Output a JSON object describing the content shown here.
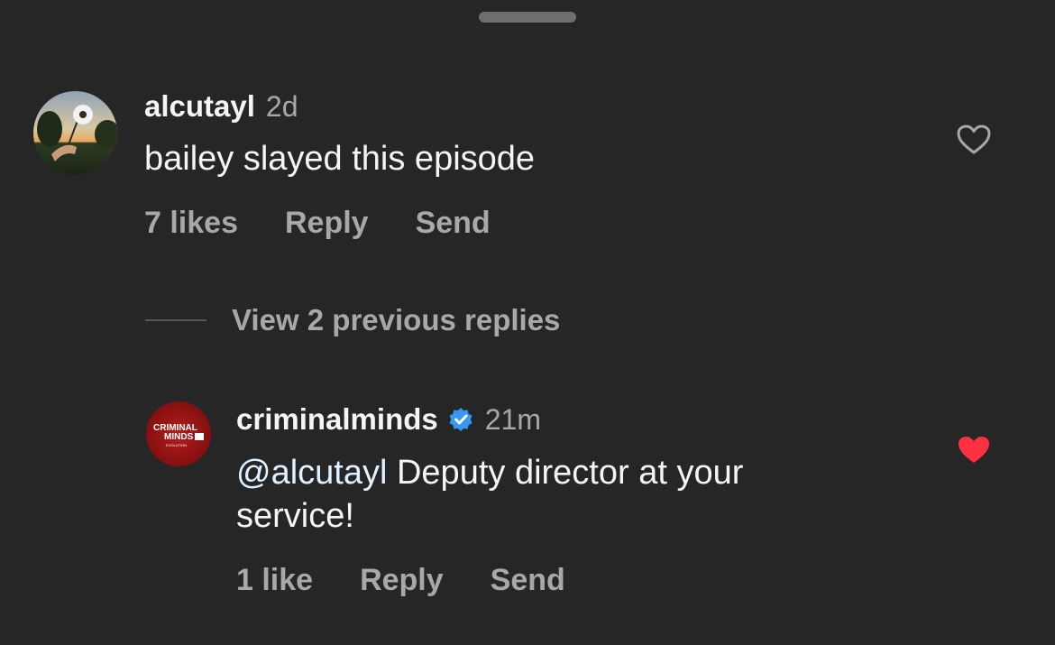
{
  "comments": [
    {
      "username": "alcutayl",
      "time": "2d",
      "text": "bailey slayed this episode",
      "likes_label": "7 likes",
      "reply_label": "Reply",
      "send_label": "Send",
      "liked": false
    },
    {
      "username": "criminalminds",
      "verified": true,
      "time": "21m",
      "mention": "@alcutayl",
      "text_line1": " Deputy director at your",
      "text_line2": "service!",
      "likes_label": "1 like",
      "reply_label": "Reply",
      "send_label": "Send",
      "liked": true,
      "avatar_logo": {
        "line1": "CRIMINAL",
        "line2": "MINDS",
        "line3": "EVOLUTION"
      }
    }
  ],
  "view_replies_label": "View 2 previous replies",
  "colors": {
    "background": "#262626",
    "muted_text": "#a8a8a8",
    "verified_badge": "#3897f0",
    "heart_liked": "#ff3040",
    "mention": "#e0f1ff"
  },
  "icons": {
    "like_empty": "heart-outline-icon",
    "like_filled": "heart-filled-icon",
    "verified": "verified-badge-icon"
  }
}
